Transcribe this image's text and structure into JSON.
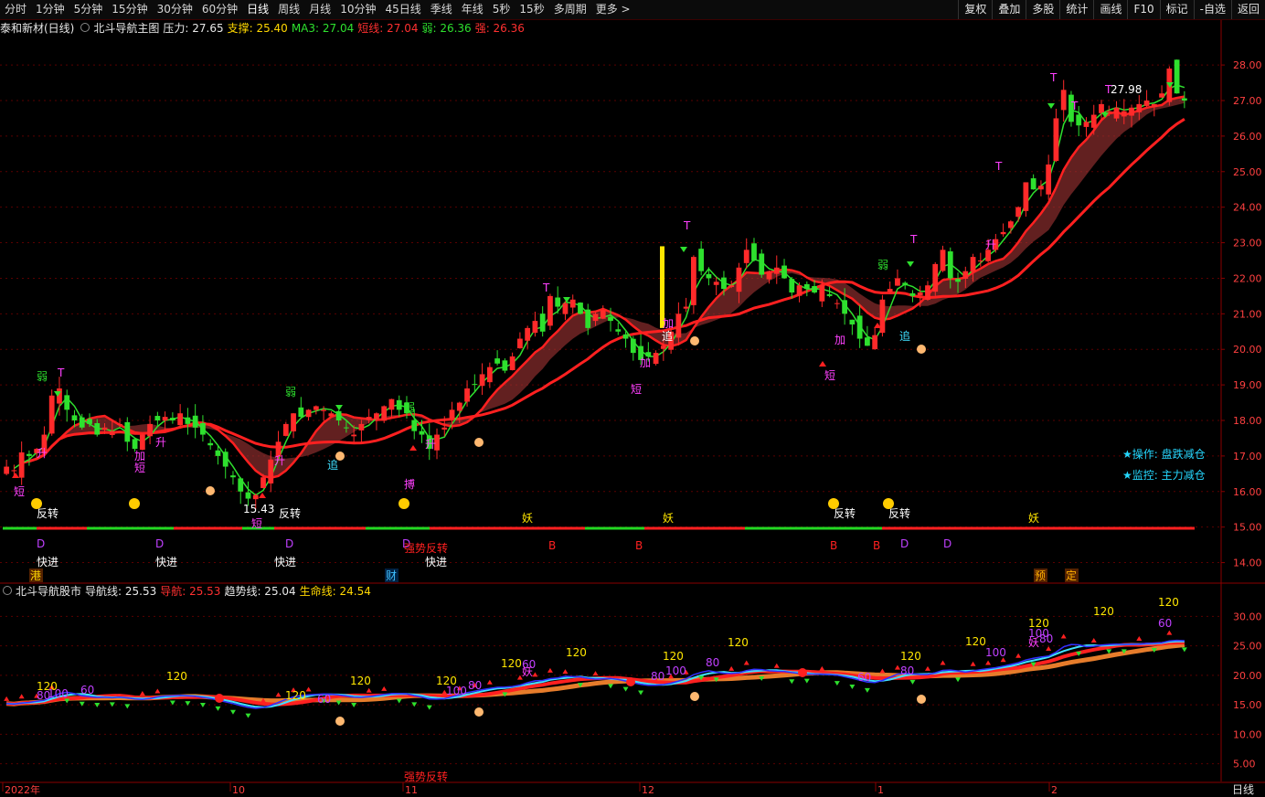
{
  "toolbar": {
    "periods": [
      "分时",
      "1分钟",
      "5分钟",
      "15分钟",
      "30分钟",
      "60分钟",
      "日线",
      "周线",
      "月线",
      "10分钟",
      "45日线",
      "季线",
      "年线",
      "5秒",
      "15秒",
      "多周期",
      "更多 >"
    ],
    "active_period": "日线",
    "buttons": [
      "复权",
      "叠加",
      "多股",
      "统计",
      "画线",
      "F10",
      "标记",
      "-自选",
      "返回"
    ]
  },
  "main_info": {
    "stock": "泰和新材(日线)",
    "indicator": "北斗导航主图",
    "pressure": "压力: 27.65",
    "support": "支撑: 25.40",
    "ma3": "MA3: 27.04",
    "short_line": "短线: 27.04",
    "weak": "弱: 26.36",
    "strong": "强: 26.36"
  },
  "sub_info": {
    "indicator": "北斗导航股市",
    "nav_line": "导航线: 25.53",
    "nav": "导航: 25.53",
    "trend_line": "趋势线: 25.04",
    "life_line": "生命线: 24.54"
  },
  "main_axis": {
    "labels": [
      "28.00",
      "27.00",
      "26.00",
      "25.00",
      "24.00",
      "23.00",
      "22.00",
      "21.00",
      "20.00",
      "19.00",
      "18.00",
      "17.00",
      "16.00",
      "15.00",
      "14.00"
    ]
  },
  "sub_axis": {
    "labels": [
      "30.00",
      "25.00",
      "20.00",
      "15.00",
      "10.00",
      "5.00"
    ]
  },
  "time_axis": {
    "labels": [
      "2022年",
      "10",
      "11",
      "12",
      "1",
      "2"
    ],
    "period": "日线"
  },
  "chart_data": {
    "type": "candlestick",
    "ylim": [
      13.5,
      28.8
    ],
    "closes": [
      16.7,
      16.6,
      17.1,
      17.0,
      17.2,
      17.6,
      18.7,
      18.9,
      18.3,
      18.0,
      17.8,
      17.9,
      17.6,
      17.8,
      17.7,
      17.9,
      17.4,
      17.2,
      17.6,
      17.9,
      18.0,
      18.1,
      18.0,
      18.2,
      17.9,
      17.8,
      17.6,
      17.3,
      17.0,
      16.7,
      16.4,
      16.0,
      15.8,
      15.9,
      16.4,
      16.9,
      17.4,
      17.9,
      18.2,
      18.1,
      18.3,
      18.4,
      18.3,
      18.2,
      18.0,
      17.8,
      17.6,
      17.9,
      18.1,
      18.2,
      18.4,
      18.6,
      18.3,
      18.2,
      17.7,
      17.6,
      17.2,
      17.6,
      17.8,
      18.3,
      18.5,
      18.9,
      19.0,
      19.3,
      19.5,
      19.6,
      19.4,
      19.8,
      20.3,
      20.6,
      20.8,
      20.5,
      21.5,
      21.2,
      21.3,
      21.4,
      21.0,
      20.6,
      21.0,
      21.1,
      20.8,
      20.5,
      20.3,
      19.9,
      19.7,
      19.8,
      19.9,
      20.1,
      20.5,
      21.0,
      21.2,
      22.6,
      22.2,
      22.0,
      21.9,
      21.7,
      21.8,
      22.3,
      22.8,
      22.5,
      22.1,
      22.2,
      22.3,
      22.0,
      21.6,
      21.8,
      21.7,
      21.6,
      21.8,
      21.5,
      21.3,
      21.0,
      20.7,
      20.3,
      20.1,
      20.4,
      21.4,
      21.7,
      22.0,
      21.8,
      21.5,
      21.6,
      21.8,
      22.4,
      22.8,
      22.0,
      21.9,
      22.2,
      22.6,
      22.5,
      22.8,
      23.1,
      23.3,
      23.6,
      24.0,
      24.7,
      24.5,
      24.6,
      25.2,
      26.5,
      27.3,
      26.4,
      26.3,
      26.4,
      26.6,
      26.9,
      26.7,
      26.8,
      26.7,
      26.8,
      26.9,
      27.0,
      26.9,
      27.2,
      27.9,
      27.2,
      27.0
    ],
    "series": [
      {
        "name": "MA3",
        "color": "#2ee02e"
      },
      {
        "name": "短线",
        "color": "#ff2a2a"
      },
      {
        "name": "弱",
        "color": "#2ee02e"
      },
      {
        "name": "强",
        "color": "#ff2a2a"
      }
    ],
    "annotations": {
      "white": [
        "反转",
        "快进",
        "15.43",
        "27.98"
      ],
      "red_b": [
        "B"
      ],
      "yellow": [
        "妖"
      ],
      "d": [
        "D"
      ],
      "pink": [
        "短",
        "加",
        "升",
        "搏",
        "追",
        "T"
      ],
      "green": [
        "弱",
        "强势反转"
      ],
      "bottom_tags": [
        "港",
        "财",
        "预",
        "定"
      ]
    },
    "sub": {
      "type": "line",
      "ylim": [
        2,
        33
      ],
      "series": [
        "导航线",
        "导航",
        "趋势线",
        "生命线"
      ],
      "labels": [
        "120",
        "100",
        "80",
        "60",
        "妖",
        "强势反转"
      ]
    }
  },
  "callouts": {
    "operation": "★操作: 盘跌减仓",
    "monitor": "★监控: 主力减仓"
  },
  "colors": {
    "up": "#ff2a2a",
    "down": "#2ee02e",
    "grid": "#5a0000",
    "axis": "#8a0000",
    "background": "#000000"
  }
}
